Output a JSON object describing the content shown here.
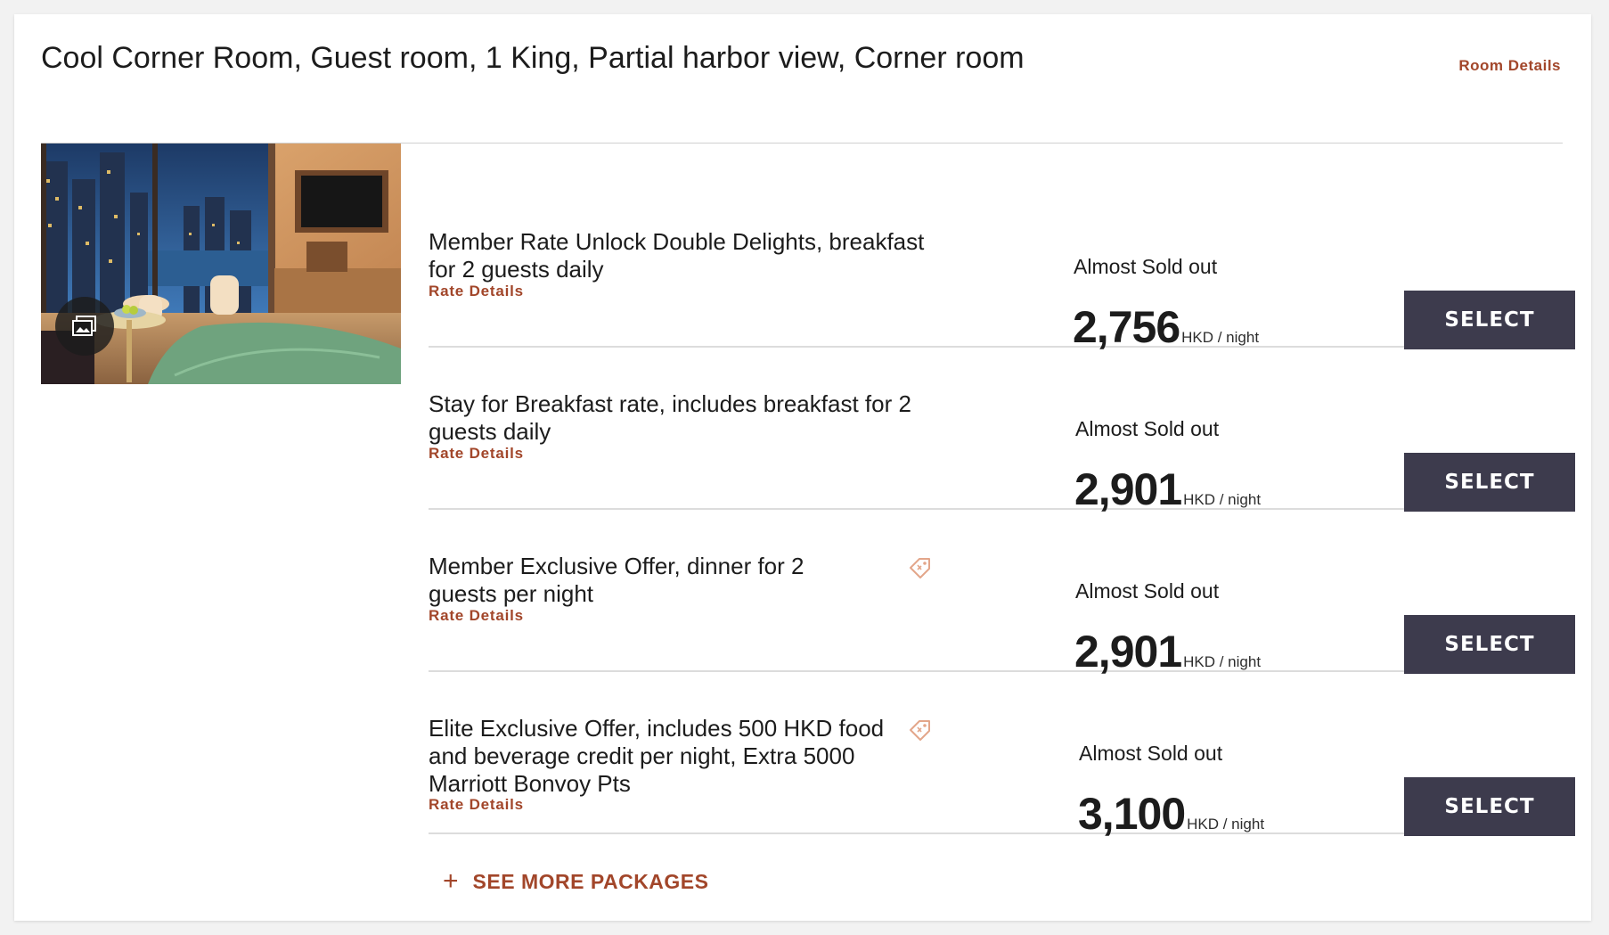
{
  "room": {
    "title": "Cool Corner Room, Guest room, 1 King, Partial harbor view, Corner room",
    "details_link": "Room Details",
    "photo_icon": "gallery-icon"
  },
  "rates": [
    {
      "name": "Member Rate Unlock Double Delights, breakfast for 2 guests daily",
      "details_label": "Rate Details",
      "availability": "Almost Sold out",
      "price": "2,756",
      "unit": "HKD / night",
      "button": "SELECT",
      "has_tag_icon": false
    },
    {
      "name": "Stay for Breakfast rate, includes breakfast for 2 guests daily",
      "details_label": "Rate Details",
      "availability": "Almost Sold out",
      "price": "2,901",
      "unit": "HKD / night",
      "button": "SELECT",
      "has_tag_icon": false
    },
    {
      "name": "Member Exclusive Offer, dinner for 2 guests per night",
      "details_label": "Rate Details",
      "availability": "Almost Sold out",
      "price": "2,901",
      "unit": "HKD / night",
      "button": "SELECT",
      "has_tag_icon": true
    },
    {
      "name": "Elite Exclusive Offer, includes 500 HKD food and beverage credit per night, Extra 5000 Marriott Bonvoy Pts",
      "details_label": "Rate Details",
      "availability": "Almost Sold out",
      "price": "3,100",
      "unit": "HKD / night",
      "button": "SELECT",
      "has_tag_icon": true
    }
  ],
  "see_more": {
    "icon": "+",
    "label": "SEE MORE PACKAGES"
  },
  "colors": {
    "accent": "#a2462a",
    "button_bg": "#3d3b4d",
    "text": "#1c1c1c",
    "divider": "#dcdcdc",
    "page_bg": "#f2f2f2"
  }
}
